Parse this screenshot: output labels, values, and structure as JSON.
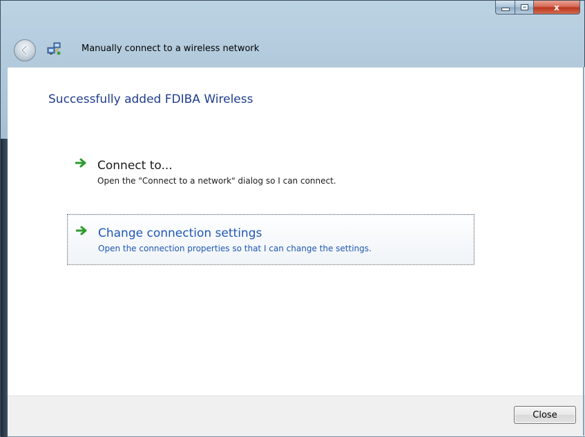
{
  "window": {
    "title": "Manually connect to a wireless network",
    "controls": {
      "minimize_icon": "minimize-icon",
      "maximize_icon": "maximize-icon",
      "close_glyph": "x"
    }
  },
  "icons": {
    "back": "back-arrow-icon",
    "network": "wireless-network-icon",
    "option_arrow": "green-arrow-icon"
  },
  "content": {
    "heading": "Successfully added FDIBA Wireless",
    "options": [
      {
        "title": "Connect to...",
        "description": "Open the \"Connect to a network\" dialog so I can connect."
      },
      {
        "title": "Change connection settings",
        "description": "Open the connection properties so that I can change the settings."
      }
    ]
  },
  "footer": {
    "close_label": "Close"
  },
  "colors": {
    "heading": "#1e3c8c",
    "link_hover": "#1e56b4",
    "arrow_green": "#2c9b2c",
    "close_button_red": "#c8452c"
  }
}
